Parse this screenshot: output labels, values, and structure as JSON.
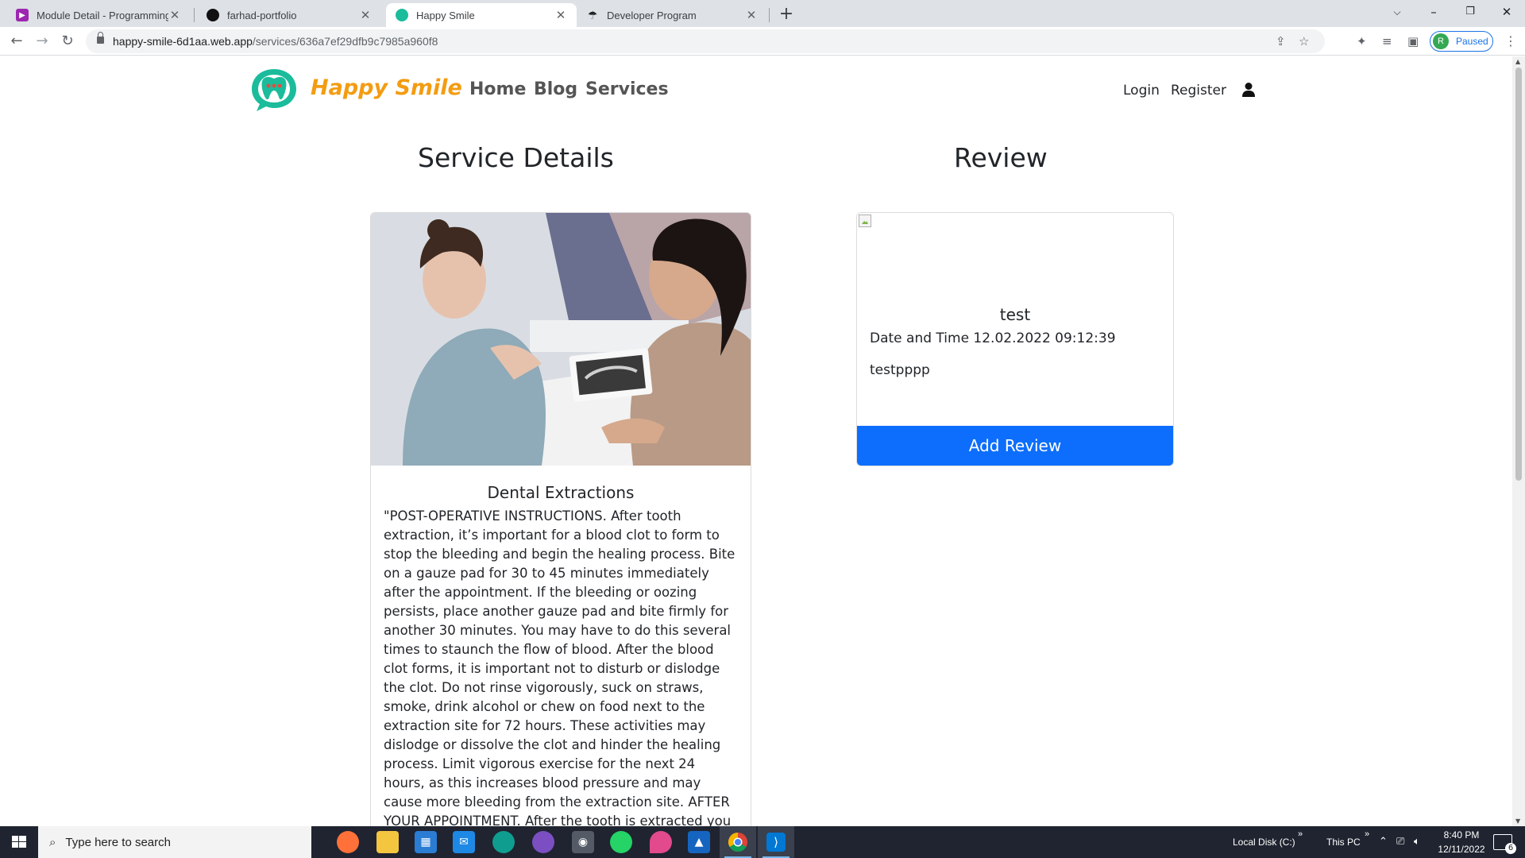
{
  "browser": {
    "tabs": [
      {
        "title": "Module Detail - Programming Hero",
        "icon": "programming-hero-favicon",
        "color": "#9c27b0"
      },
      {
        "title": "farhad-portfolio",
        "icon": "portfolio-favicon",
        "color": "#111111"
      },
      {
        "title": "Happy Smile",
        "icon": "happy-smile-favicon",
        "color": "#1abc9c"
      },
      {
        "title": "Developer Program",
        "icon": "developer-program-favicon",
        "color": "#222222"
      }
    ],
    "url_host": "happy-smile-6d1aa.web.app",
    "url_path": "/services/636a7ef29dfb9c7985a960f8",
    "profile_initial": "R",
    "profile_status": "Paused"
  },
  "site": {
    "brand": "Happy Smile",
    "brand_color": "#f39c12",
    "nav": [
      "Home",
      "Blog",
      "Services"
    ],
    "login": "Login",
    "register": "Register"
  },
  "service": {
    "section_title": "Service Details",
    "name": "Dental Extractions",
    "description": "\"POST-OPERATIVE INSTRUCTIONS. After tooth extraction, it’s important for a blood clot to form to stop the bleeding and begin the healing process. Bite on a gauze pad for 30 to 45 minutes immediately after the appointment. If the bleeding or oozing persists, place another gauze pad and bite firmly for another 30 minutes. You may have to do this several times to staunch the flow of blood. After the blood clot forms, it is important not to disturb or dislodge the clot. Do not rinse vigorously, suck on straws, smoke, drink alcohol or chew on food next to the extraction site for 72 hours. These activities may dislodge or dissolve the clot and hinder the healing process. Limit vigorous exercise for the next 24 hours, as this increases blood pressure and may cause more bleeding from the extraction site. AFTER YOUR APPOINTMENT. After the tooth is extracted you may feel some pain and"
  },
  "review": {
    "section_title": "Review",
    "reviewer": "test",
    "date_label": "Date and Time 12.02.2022 09:12:39",
    "text": "testpppp",
    "add_button": "Add Review",
    "button_color": "#0d6efd"
  },
  "taskbar": {
    "search_placeholder": "Type here to search",
    "apps": [
      "firefox-icon",
      "file-explorer-icon",
      "microsoft-store-icon",
      "mail-icon",
      "edge-icon",
      "viber-icon",
      "camera-icon",
      "whatsapp-icon",
      "color-picker-icon",
      "photos-icon",
      "chrome-icon",
      "vscode-icon"
    ],
    "toolbar_local_disk": "Local Disk (C:)",
    "toolbar_this_pc": "This PC",
    "time": "8:40 PM",
    "date": "12/11/2022",
    "notification_count": "6"
  }
}
